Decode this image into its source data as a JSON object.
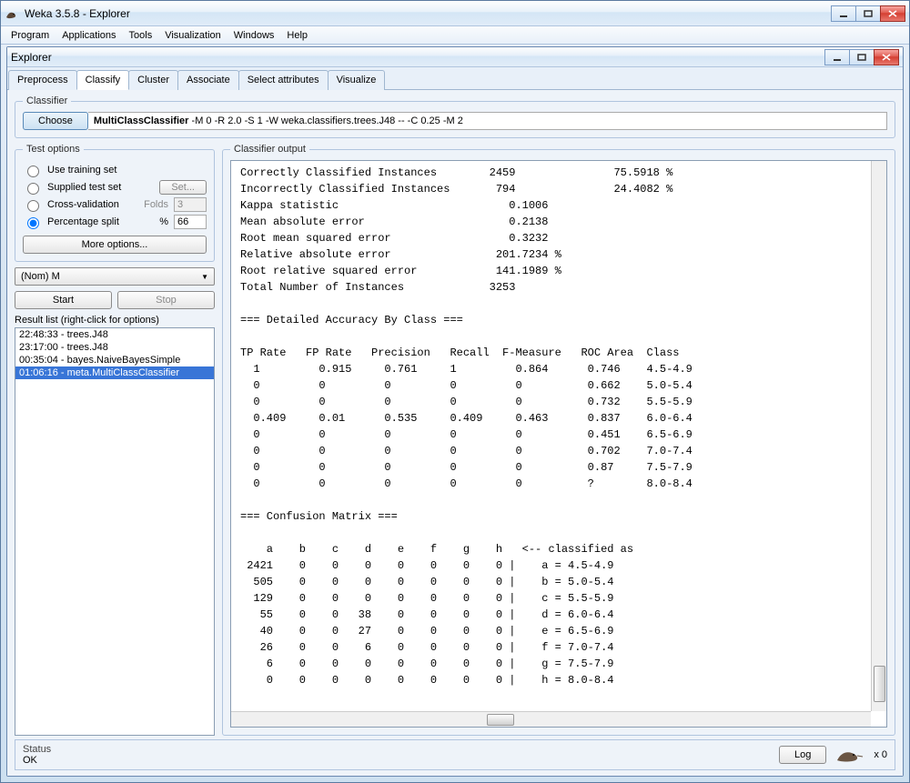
{
  "window": {
    "title": "Weka 3.5.8 - Explorer"
  },
  "menu": {
    "items": [
      "Program",
      "Applications",
      "Tools",
      "Visualization",
      "Windows",
      "Help"
    ]
  },
  "inner": {
    "title": "Explorer"
  },
  "tabs": [
    {
      "label": "Preprocess",
      "active": false
    },
    {
      "label": "Classify",
      "active": true
    },
    {
      "label": "Cluster",
      "active": false
    },
    {
      "label": "Associate",
      "active": false
    },
    {
      "label": "Select attributes",
      "active": false
    },
    {
      "label": "Visualize",
      "active": false
    }
  ],
  "classifier_group": {
    "legend": "Classifier",
    "choose_label": "Choose",
    "name": "MultiClassClassifier",
    "params": " -M 0 -R 2.0 -S 1 -W weka.classifiers.trees.J48 -- -C 0.25 -M 2"
  },
  "test_options": {
    "legend": "Test options",
    "training_label": "Use training set",
    "supplied_label": "Supplied test set",
    "set_button": "Set...",
    "cv_label": "Cross-validation",
    "folds_label": "Folds",
    "folds_value": "3",
    "split_label": "Percentage split",
    "percent_symbol": "%",
    "split_value": "66",
    "more_options": "More options..."
  },
  "attribute_combo": "(Nom) M",
  "start_label": "Start",
  "stop_label": "Stop",
  "result_list_label": "Result list (right-click for options)",
  "result_list": [
    {
      "label": "22:48:33 - trees.J48",
      "selected": false
    },
    {
      "label": "23:17:00 - trees.J48",
      "selected": false
    },
    {
      "label": "00:35:04 - bayes.NaiveBayesSimple",
      "selected": false
    },
    {
      "label": "01:06:16 - meta.MultiClassClassifier",
      "selected": true
    }
  ],
  "output_legend": "Classifier output",
  "output_text": "Correctly Classified Instances        2459               75.5918 %\nIncorrectly Classified Instances       794               24.4082 %\nKappa statistic                          0.1006\nMean absolute error                      0.2138\nRoot mean squared error                  0.3232\nRelative absolute error                201.7234 %\nRoot relative squared error            141.1989 %\nTotal Number of Instances             3253\n\n=== Detailed Accuracy By Class ===\n\nTP Rate   FP Rate   Precision   Recall  F-Measure   ROC Area  Class\n  1         0.915     0.761     1         0.864      0.746    4.5-4.9\n  0         0         0         0         0          0.662    5.0-5.4\n  0         0         0         0         0          0.732    5.5-5.9\n  0.409     0.01      0.535     0.409     0.463      0.837    6.0-6.4\n  0         0         0         0         0          0.451    6.5-6.9\n  0         0         0         0         0          0.702    7.0-7.4\n  0         0         0         0         0          0.87     7.5-7.9\n  0         0         0         0         0          ?        8.0-8.4\n\n=== Confusion Matrix ===\n\n    a    b    c    d    e    f    g    h   <-- classified as\n 2421    0    0    0    0    0    0    0 |    a = 4.5-4.9\n  505    0    0    0    0    0    0    0 |    b = 5.0-5.4\n  129    0    0    0    0    0    0    0 |    c = 5.5-5.9\n   55    0    0   38    0    0    0    0 |    d = 6.0-6.4\n   40    0    0   27    0    0    0    0 |    e = 6.5-6.9\n   26    0    0    6    0    0    0    0 |    f = 7.0-7.4\n    6    0    0    0    0    0    0    0 |    g = 7.5-7.9\n    0    0    0    0    0    0    0    0 |    h = 8.0-8.4\n",
  "status": {
    "label": "Status",
    "value": "OK",
    "log_button": "Log",
    "count_suffix": "x 0"
  }
}
